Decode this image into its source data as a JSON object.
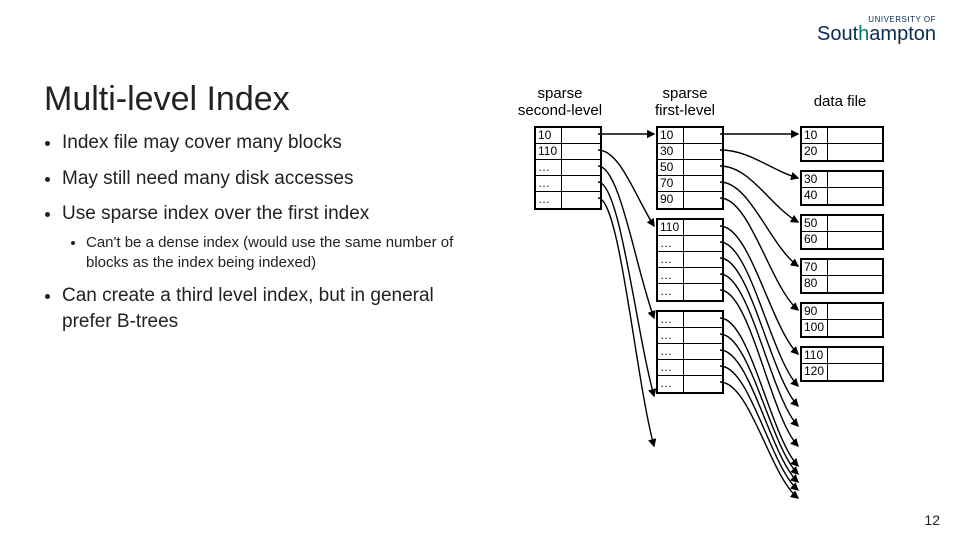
{
  "logo": {
    "small": "UNIVERSITY OF",
    "main_pre": "Sout",
    "main_h": "h",
    "main_post": "ampton"
  },
  "title": "Multi-level Index",
  "bullets": {
    "b1": "Index file may cover many blocks",
    "b2": "May still need many disk accesses",
    "b3": "Use sparse index over the first index",
    "b3a": "Can't be a dense index (would use the same number of blocks as the index being indexed)",
    "b4": "Can create a third level index, but in general prefer B-trees"
  },
  "headers": {
    "second": "sparse\nsecond-level",
    "first": "sparse\nfirst-level",
    "data": "data file"
  },
  "second_level": {
    "r0": "10",
    "r1": "110",
    "r2": "…",
    "r3": "…",
    "r4": "…"
  },
  "first_block1": {
    "r0": "10",
    "r1": "30",
    "r2": "50",
    "r3": "70",
    "r4": "90"
  },
  "first_block2": {
    "r0": "110",
    "r1": "…",
    "r2": "…",
    "r3": "…",
    "r4": "…"
  },
  "first_block3": {
    "r0": "…",
    "r1": "…",
    "r2": "…",
    "r3": "…",
    "r4": "…"
  },
  "data_blocks": {
    "b0": {
      "r0": "10",
      "r1": "20"
    },
    "b1": {
      "r0": "30",
      "r1": "40"
    },
    "b2": {
      "r0": "50",
      "r1": "60"
    },
    "b3": {
      "r0": "70",
      "r1": "80"
    },
    "b4": {
      "r0": "90",
      "r1": "100"
    },
    "b5": {
      "r0": "110",
      "r1": "120"
    }
  },
  "pagenum": "12"
}
